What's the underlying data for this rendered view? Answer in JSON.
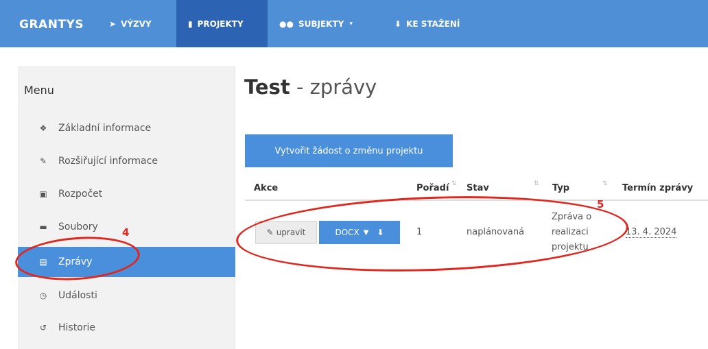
{
  "navbar": {
    "brand": "GRANTYS",
    "items": [
      {
        "label": "VÝZVY",
        "icon": "bullhorn-icon",
        "glyph": "📢"
      },
      {
        "label": "PROJEKTY",
        "icon": "file-icon",
        "glyph": "▶"
      },
      {
        "label": "SUBJEKTY",
        "icon": "users-icon",
        "glyph": "👥",
        "caret": "▾"
      },
      {
        "label": "KE STAŽENÍ",
        "icon": "download-icon",
        "glyph": "⬇"
      }
    ]
  },
  "sidebar": {
    "title": "Menu",
    "items": [
      {
        "label": "Základní informace",
        "icon": "info-circle-icon",
        "glyph": "ℹ"
      },
      {
        "label": "Rozšiřující informace",
        "icon": "edit-icon",
        "glyph": "✎"
      },
      {
        "label": "Rozpočet",
        "icon": "money-icon",
        "glyph": "▣"
      },
      {
        "label": "Soubory",
        "icon": "folder-icon",
        "glyph": "▬"
      },
      {
        "label": "Zprávy",
        "icon": "list-icon",
        "glyph": "▤"
      },
      {
        "label": "Události",
        "icon": "clock-icon",
        "glyph": "◷"
      },
      {
        "label": "Historie",
        "icon": "history-icon",
        "glyph": "↺"
      }
    ]
  },
  "main": {
    "title_bold": "Test",
    "title_rest": " - zprávy",
    "create_button": "Vytvořit žádost o změnu projektu",
    "columns": [
      "Akce",
      "Pořadí",
      "Stav",
      "Typ",
      "Termín zprávy"
    ],
    "row": {
      "edit_label": "upravit",
      "docx_label": "DOCX",
      "order": "1",
      "status": "naplánovaná",
      "type": "Zpráva o realizaci projektu",
      "deadline": "13. 4. 2024"
    }
  },
  "annotations": {
    "sidebar_number": "4",
    "table_number": "5"
  },
  "colors": {
    "navbar": "#4f8fd6",
    "navbar_active": "#2c64b3",
    "accent": "#4a8fdb",
    "annotation": "#e0261d"
  }
}
